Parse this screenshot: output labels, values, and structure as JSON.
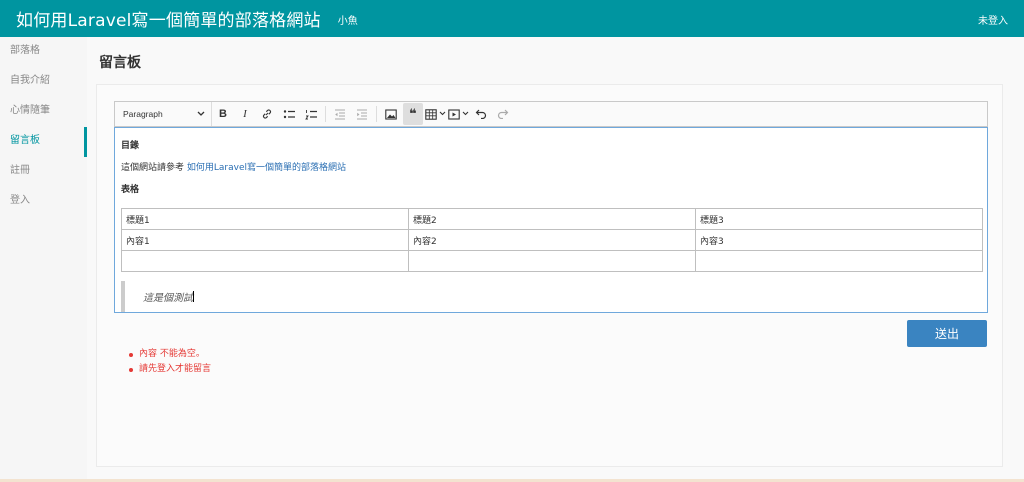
{
  "header": {
    "site_title": "如何用Laravel寫一個簡單的部落格網站",
    "author": "小魚",
    "login_status": "未登入",
    "accent_color": "#0095a0"
  },
  "sidebar": {
    "items": [
      {
        "label": "部落格",
        "active": false
      },
      {
        "label": "自我介紹",
        "active": false
      },
      {
        "label": "心情隨筆",
        "active": false
      },
      {
        "label": "留言板",
        "active": true
      },
      {
        "label": "註冊",
        "active": false
      },
      {
        "label": "登入",
        "active": false
      }
    ]
  },
  "page": {
    "title": "留言板"
  },
  "toolbar": {
    "heading_select": "Paragraph",
    "buttons": [
      "bold-icon",
      "italic-icon",
      "link-icon",
      "bulleted-list-icon",
      "numbered-list-icon",
      "outdent-icon",
      "indent-icon",
      "image-icon",
      "blockquote-icon",
      "table-icon",
      "media-icon",
      "undo-icon",
      "redo-icon"
    ]
  },
  "editor": {
    "heading1": "目錄",
    "reference_prefix": "這個網站請參考 ",
    "reference_link": "如何用Laravel寫一個簡單的部落格網站",
    "heading2": "表格",
    "table": [
      [
        "標題1",
        "標題2",
        "標題3"
      ],
      [
        "內容1",
        "內容2",
        "內容3"
      ],
      [
        "",
        "",
        ""
      ]
    ],
    "quote": "這是個測試"
  },
  "submit": {
    "label": "送出"
  },
  "errors": [
    "內容 不能為空。",
    "請先登入才能留言"
  ]
}
